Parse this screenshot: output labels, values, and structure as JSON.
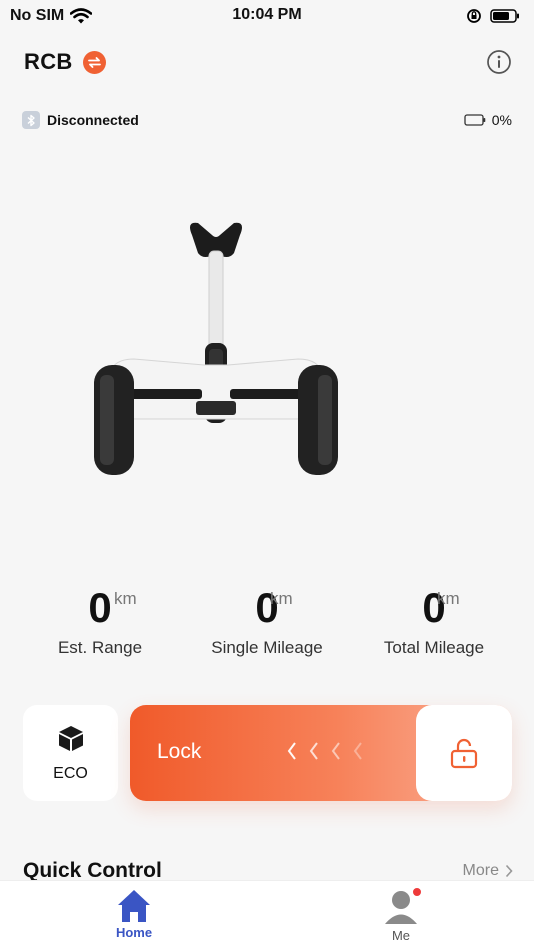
{
  "status_bar": {
    "carrier": "No SIM",
    "time": "10:04 PM"
  },
  "header": {
    "device_name": "RCB"
  },
  "connection": {
    "status": "Disconnected",
    "battery_percent": "0%"
  },
  "stats": [
    {
      "value": "0",
      "unit": "km",
      "label": "Est. Range"
    },
    {
      "value": "0",
      "unit": "km",
      "label": "Single Mileage"
    },
    {
      "value": "0",
      "unit": "km",
      "label": "Total Mileage"
    }
  ],
  "mode": {
    "label": "ECO"
  },
  "lock": {
    "label": "Lock"
  },
  "quick_control": {
    "title": "Quick Control",
    "more_label": "More"
  },
  "tabs": [
    {
      "label": "Home",
      "active": true
    },
    {
      "label": "Me",
      "active": false
    }
  ],
  "colors": {
    "accent": "#f06133",
    "tab_active": "#3a55c4",
    "notification": "#ee3a3a"
  }
}
